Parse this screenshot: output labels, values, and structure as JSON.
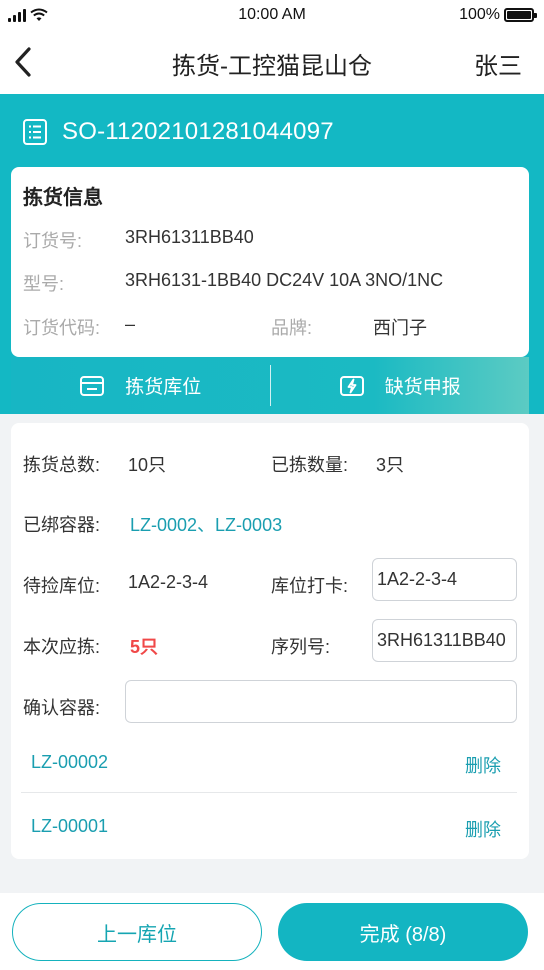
{
  "status": {
    "time": "10:00 AM",
    "battery": "100%"
  },
  "nav": {
    "title": "拣货-工控猫昆山仓",
    "user": "张三"
  },
  "order": {
    "number": "SO-11202101281044097"
  },
  "info": {
    "title": "拣货信息",
    "order_no_label": "订货号:",
    "order_no_value": "3RH61311BB40",
    "model_label": "型号:",
    "model_value": "3RH6131-1BB40 DC24V 10A 3NO/1NC",
    "code_label": "订货代码:",
    "code_value": "–",
    "brand_label": "品牌:",
    "brand_value": "西门子"
  },
  "actions": {
    "pick_location": "拣货库位",
    "shortage_report": "缺货申报"
  },
  "detail": {
    "total_label": "拣货总数:",
    "total_value": "10只",
    "picked_label": "已拣数量:",
    "picked_value": "3只",
    "bound_label": "已绑容器:",
    "bound_value": "LZ-0002、LZ-0003",
    "pending_label": "待捡库位:",
    "pending_value": "1A2-2-3-4",
    "checkin_label": "库位打卡:",
    "checkin_value": "1A2-2-3-4",
    "should_label": "本次应拣:",
    "should_value": "5只",
    "serial_label": "序列号:",
    "serial_value": "3RH61311BB40",
    "confirm_label": "确认容器:",
    "confirm_value": ""
  },
  "containers": [
    {
      "code": "LZ-00002",
      "action": "删除"
    },
    {
      "code": "LZ-00001",
      "action": "删除"
    }
  ],
  "buttons": {
    "prev": "上一库位",
    "done": "完成 (8/8)"
  },
  "colors": {
    "accent": "#13b8c4",
    "link": "#1a9eb0",
    "warning": "#f04848"
  }
}
